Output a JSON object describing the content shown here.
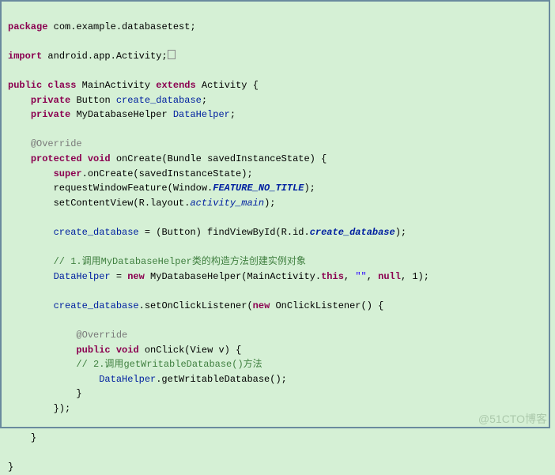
{
  "kw": {
    "package": "package",
    "import": "import",
    "public": "public",
    "class": "class",
    "extends": "extends",
    "private": "private",
    "protected": "protected",
    "void": "void",
    "super": "super",
    "new": "new",
    "this": "this",
    "null": "null"
  },
  "t": {
    "pkgname": "com.example.databasetest;",
    "importLine": "android.app.Activity;",
    "MainActivity": "MainActivity",
    "Activity": "Activity",
    "ob": "{",
    "cb": "}",
    "Button": "Button",
    "create_database": "create_database",
    "semi": ";",
    "MyDatabaseHelper": "MyDatabaseHelper",
    "DataHelper": "DataHelper",
    "Override": "@Override",
    "onCreateSig": "onCreate(Bundle savedInstanceState) {",
    "superCall": ".onCreate(savedInstanceState);",
    "reqWin_a": "requestWindowFeature(Window.",
    "FEATURE_NO_TITLE": "FEATURE_NO_TITLE",
    "reqWin_b": ");",
    "setCV_a": "setContentView(R.layout.",
    "activity_main": "activity_main",
    "setCV_b": ");",
    "fvb_a": " = (Button) findViewById(R.id.",
    "fvb_b": ");",
    "cmt1_a": "// 1.调用",
    "cmt1_b": "MyDatabaseHelper",
    "cmt1_c": "类的构造方法创建实例对象",
    "dh_a": " = ",
    "dh_b": " MyDatabaseHelper(MainActivity.",
    "dh_c": ", ",
    "str": "\"\"",
    "dh_d": ", ",
    "dh_e": ", 1);",
    "socl_a": ".setOnClickListener(",
    "socl_b": " OnClickListener() {",
    "onClickSig": "onClick(View v) {",
    "cmt2_a": "// 2.调用",
    "cmt2_b": "getWritableDatabase()",
    "cmt2_c": "方法",
    "gwd": ".getWritableDatabase();",
    "closeAnon": "});"
  },
  "watermark": "@51CTO博客"
}
